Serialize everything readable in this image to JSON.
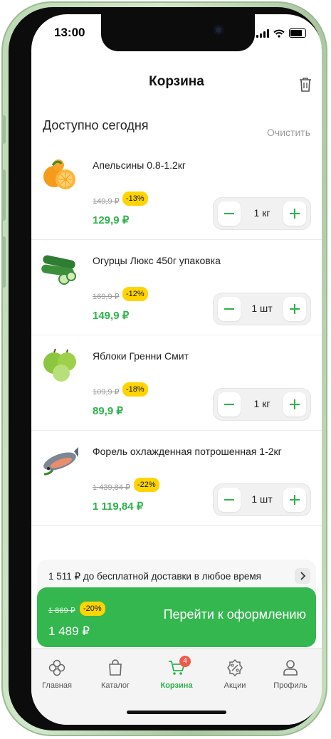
{
  "status_bar": {
    "time": "13:00"
  },
  "header": {
    "title": "Корзина"
  },
  "section": {
    "title": "Доступно сегодня",
    "clear_label": "Очистить"
  },
  "cart_items": [
    {
      "name": "Апельсины 0.8-1.2кг",
      "old_price": "149,9 ₽",
      "discount": "-13%",
      "price": "129,9 ₽",
      "quantity": "1 кг",
      "image_icon": "orange-icon"
    },
    {
      "name": "Огурцы Люкс 450г упаковка",
      "old_price": "169,9 ₽",
      "discount": "-12%",
      "price": "149,9 ₽",
      "quantity": "1 шт",
      "image_icon": "cucumber-icon"
    },
    {
      "name": "Яблоки Гренни Смит",
      "old_price": "109,9 ₽",
      "discount": "-18%",
      "price": "89,9 ₽",
      "quantity": "1 кг",
      "image_icon": "apple-icon"
    },
    {
      "name": "Форель охлажденная потрошенная 1-2кг",
      "old_price": "1 439,84 ₽",
      "discount": "-22%",
      "price": "1 119,84 ₽",
      "quantity": "1 шт",
      "image_icon": "fish-icon"
    }
  ],
  "delivery": {
    "text": "1 511 ₽ до бесплатной доставки в любое время"
  },
  "checkout": {
    "old_total": "1 869 ₽",
    "discount": "-20%",
    "total": "1 489 ₽",
    "button_label": "Перейти к оформлению"
  },
  "tabbar": {
    "items": [
      {
        "label": "Главная",
        "icon": "home-flower-icon",
        "active": false
      },
      {
        "label": "Каталог",
        "icon": "shopping-bag-icon",
        "active": false
      },
      {
        "label": "Корзина",
        "icon": "cart-icon",
        "active": true,
        "badge": "4"
      },
      {
        "label": "Акции",
        "icon": "percent-badge-icon",
        "active": false
      },
      {
        "label": "Профиль",
        "icon": "profile-icon",
        "active": false
      }
    ]
  },
  "colors": {
    "accent_green": "#2db34a",
    "checkout_green": "#34b74f",
    "discount_yellow": "#ffd400",
    "badge_red": "#f05a4a"
  }
}
